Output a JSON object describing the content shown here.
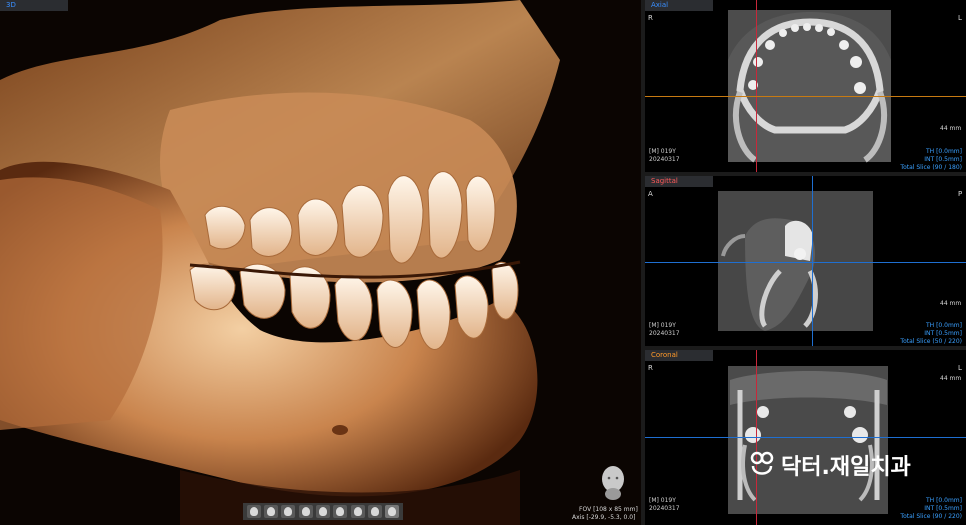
{
  "view3d": {
    "tab_label": "3D",
    "fov": "FOV [108 x 85 mm]",
    "axis": "Axis [-29.9, -5.3, 0.0]",
    "toolbar_count": 9
  },
  "axial": {
    "tab_label": "Axial",
    "left_marker": "R",
    "right_marker": "L",
    "scale": "44 mm",
    "patient": "[M] 019Y",
    "date": "20240317",
    "th": "TH [0.0mm]",
    "int": "INT [0.5mm]",
    "slice": "Total Slice (90 / 180)"
  },
  "sagittal": {
    "tab_label": "Sagittal",
    "left_marker": "A",
    "right_marker": "P",
    "scale": "44 mm",
    "patient": "[M] 019Y",
    "date": "20240317",
    "th": "TH [0.0mm]",
    "int": "INT [0.5mm]",
    "slice": "Total Slice (50 / 220)"
  },
  "coronal": {
    "tab_label": "Coronal",
    "left_marker": "R",
    "right_marker": "L",
    "scale": "44 mm",
    "patient": "[M] 019Y",
    "date": "20240317",
    "th": "TH [0.0mm]",
    "int": "INT [0.5mm]",
    "slice": "Total Slice (90 / 220)"
  },
  "watermark": {
    "text": "닥터.재일치과"
  },
  "colors": {
    "axial_tab": "#3a8fff",
    "sagittal_tab": "#ff5a5a",
    "coronal_tab": "#ff9a2a",
    "crosshair_red": "#c8283a",
    "crosshair_blue": "#1f6fd1",
    "crosshair_orange": "#c77a12"
  }
}
